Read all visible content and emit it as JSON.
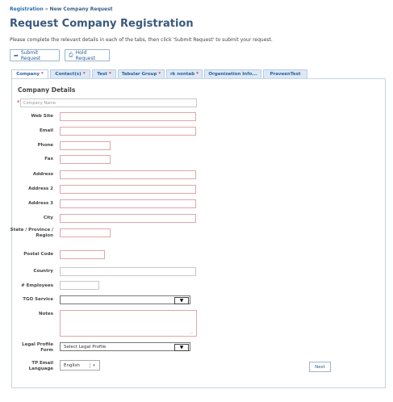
{
  "breadcrumb": {
    "root": "Registration",
    "separator": "»",
    "current": "New Company Request"
  },
  "page_title": "Request Company Registration",
  "intro": "Please complete the relevant details in each of the tabs, then click 'Submit Request' to submit your request.",
  "toolbar": {
    "submit_label": "Submit Request",
    "hold_label": "Hold Request"
  },
  "tabs": [
    {
      "label": "Company",
      "required": "*"
    },
    {
      "label": "Contact(s)",
      "required": "*"
    },
    {
      "label": "Test",
      "required": "*"
    },
    {
      "label": "Tabular Group",
      "required": "*"
    },
    {
      "label": "rk nontab",
      "required": "*"
    },
    {
      "label": "Organization Info...",
      "required": ""
    },
    {
      "label": "PraveenTest",
      "required": ""
    }
  ],
  "section": {
    "title": "Company Details"
  },
  "company_name": {
    "required": "*",
    "placeholder": "Company Name"
  },
  "labels": {
    "website": "Web Site",
    "email": "Email",
    "phone": "Phone",
    "fax": "Fax",
    "address": "Address",
    "address2": "Address 2",
    "address3": "Address 3",
    "city": "City",
    "state": "State / Province / Region",
    "postal": "Postal Code",
    "country": "Country",
    "employees": "# Employees",
    "tgo": "TGO Service",
    "notes": "Notes",
    "legal": "Legal Profile Form",
    "tp_lang": "TP Email Language"
  },
  "legal_select": {
    "value": "Select Legal Profile"
  },
  "tgo_select": {
    "value": ""
  },
  "tp_lang_select": {
    "value": "English"
  },
  "next_label": "Next"
}
